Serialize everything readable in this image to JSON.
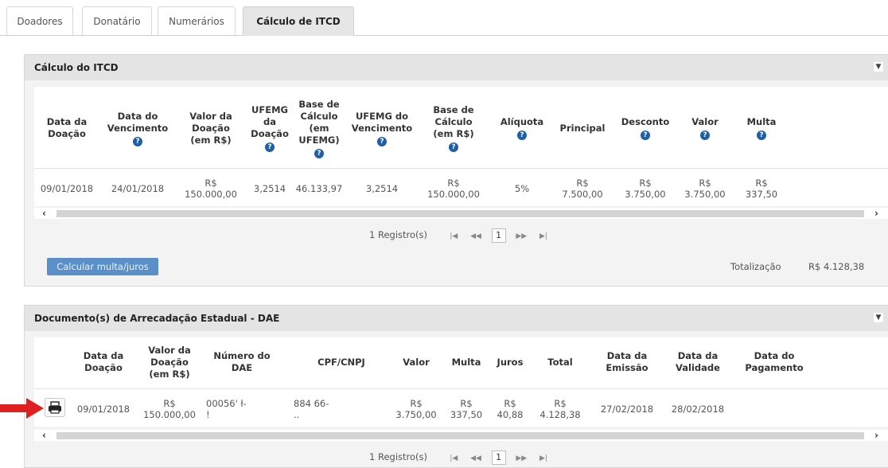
{
  "tabs": [
    "Doadores",
    "Donatário",
    "Numerários",
    "Cálculo de ITCD"
  ],
  "calc_panel": {
    "title": "Cálculo do ITCD",
    "headers": [
      "Data da\nDoação",
      "Data do\nVencimento",
      "Valor da\nDoação\n(em R$)",
      "UFEMG\nda\nDoação",
      "Base de\nCálculo\n(em\nUFEMG)",
      "UFEMG do\nVencimento",
      "Base de\nCálculo\n(em R$)",
      "Alíquota",
      "Principal",
      "Desconto",
      "Valor",
      "Multa"
    ],
    "row": [
      "09/01/2018",
      "24/01/2018",
      "R$\n150.000,00",
      "3,2514",
      "46.133,97",
      "3,2514",
      "R$\n150.000,00",
      "5%",
      "R$\n7.500,00",
      "R$\n3.750,00",
      "R$\n3.750,00",
      "R$\n337,50"
    ],
    "pager_label": "1 Registro(s)",
    "page": "1",
    "calc_button": "Calcular multa/juros",
    "total_label": "Totalização",
    "total_value": "R$ 4.128,38"
  },
  "dae_panel": {
    "title": "Documento(s) de Arrecadação Estadual - DAE",
    "headers": [
      "Data da\nDoação",
      "Valor da\nDoação\n(em R$)",
      "Número do\nDAE",
      "CPF/CNPJ",
      "Valor",
      "Multa",
      "Juros",
      "Total",
      "Data da\nEmissão",
      "Data da\nValidade",
      "Data do\nPagamento"
    ],
    "row": [
      "09/01/2018",
      "R$\n150.000,00",
      "00056'     ł-\n                    !",
      "884           66-\n                  ..",
      "R$\n3.750,00",
      "R$\n337,50",
      "R$\n40,88",
      "R$\n4.128,38",
      "27/02/2018",
      "28/02/2018",
      ""
    ],
    "pager_label": "1 Registro(s)",
    "page": "1"
  },
  "colors": {
    "arrow": "#e02020",
    "button": "#5b8fc7",
    "icon": "#1d5fa8"
  },
  "icons": {
    "help": "question-circle-icon",
    "print": "printer-icon",
    "collapse": "caret-down-icon"
  }
}
